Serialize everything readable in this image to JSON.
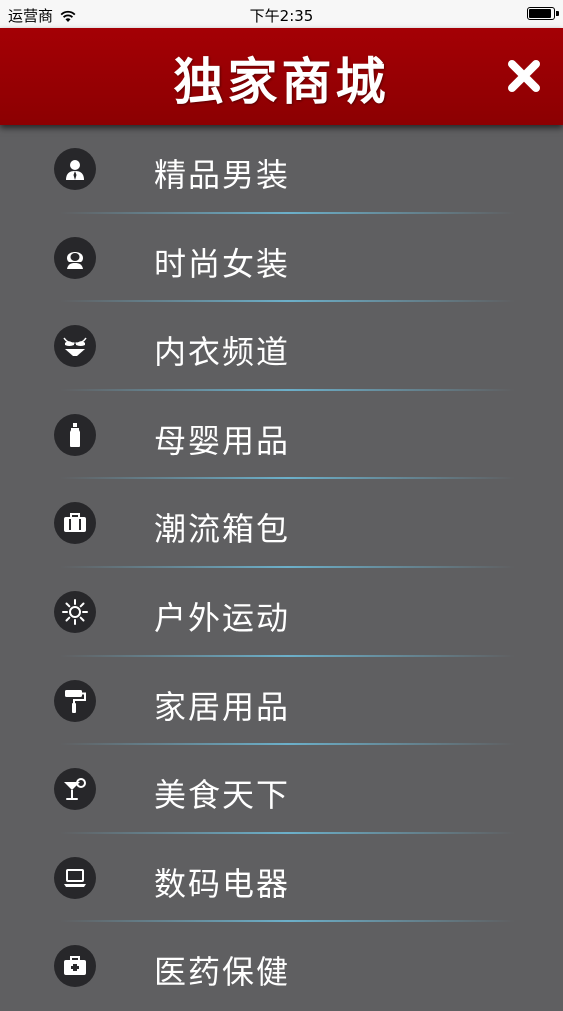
{
  "status_bar": {
    "carrier": "运营商",
    "time": "下午2:35"
  },
  "header": {
    "title": "独家商城"
  },
  "menu": {
    "items": [
      {
        "label": "精品男装",
        "icon": "man-icon"
      },
      {
        "label": "时尚女装",
        "icon": "woman-icon"
      },
      {
        "label": "内衣频道",
        "icon": "bikini-icon"
      },
      {
        "label": "母婴用品",
        "icon": "baby-bottle-icon"
      },
      {
        "label": "潮流箱包",
        "icon": "suitcase-icon"
      },
      {
        "label": "户外运动",
        "icon": "sun-icon"
      },
      {
        "label": "家居用品",
        "icon": "paint-roller-icon"
      },
      {
        "label": "美食天下",
        "icon": "cocktail-icon"
      },
      {
        "label": "数码电器",
        "icon": "laptop-icon"
      },
      {
        "label": "医药保健",
        "icon": "medical-kit-icon"
      }
    ]
  }
}
